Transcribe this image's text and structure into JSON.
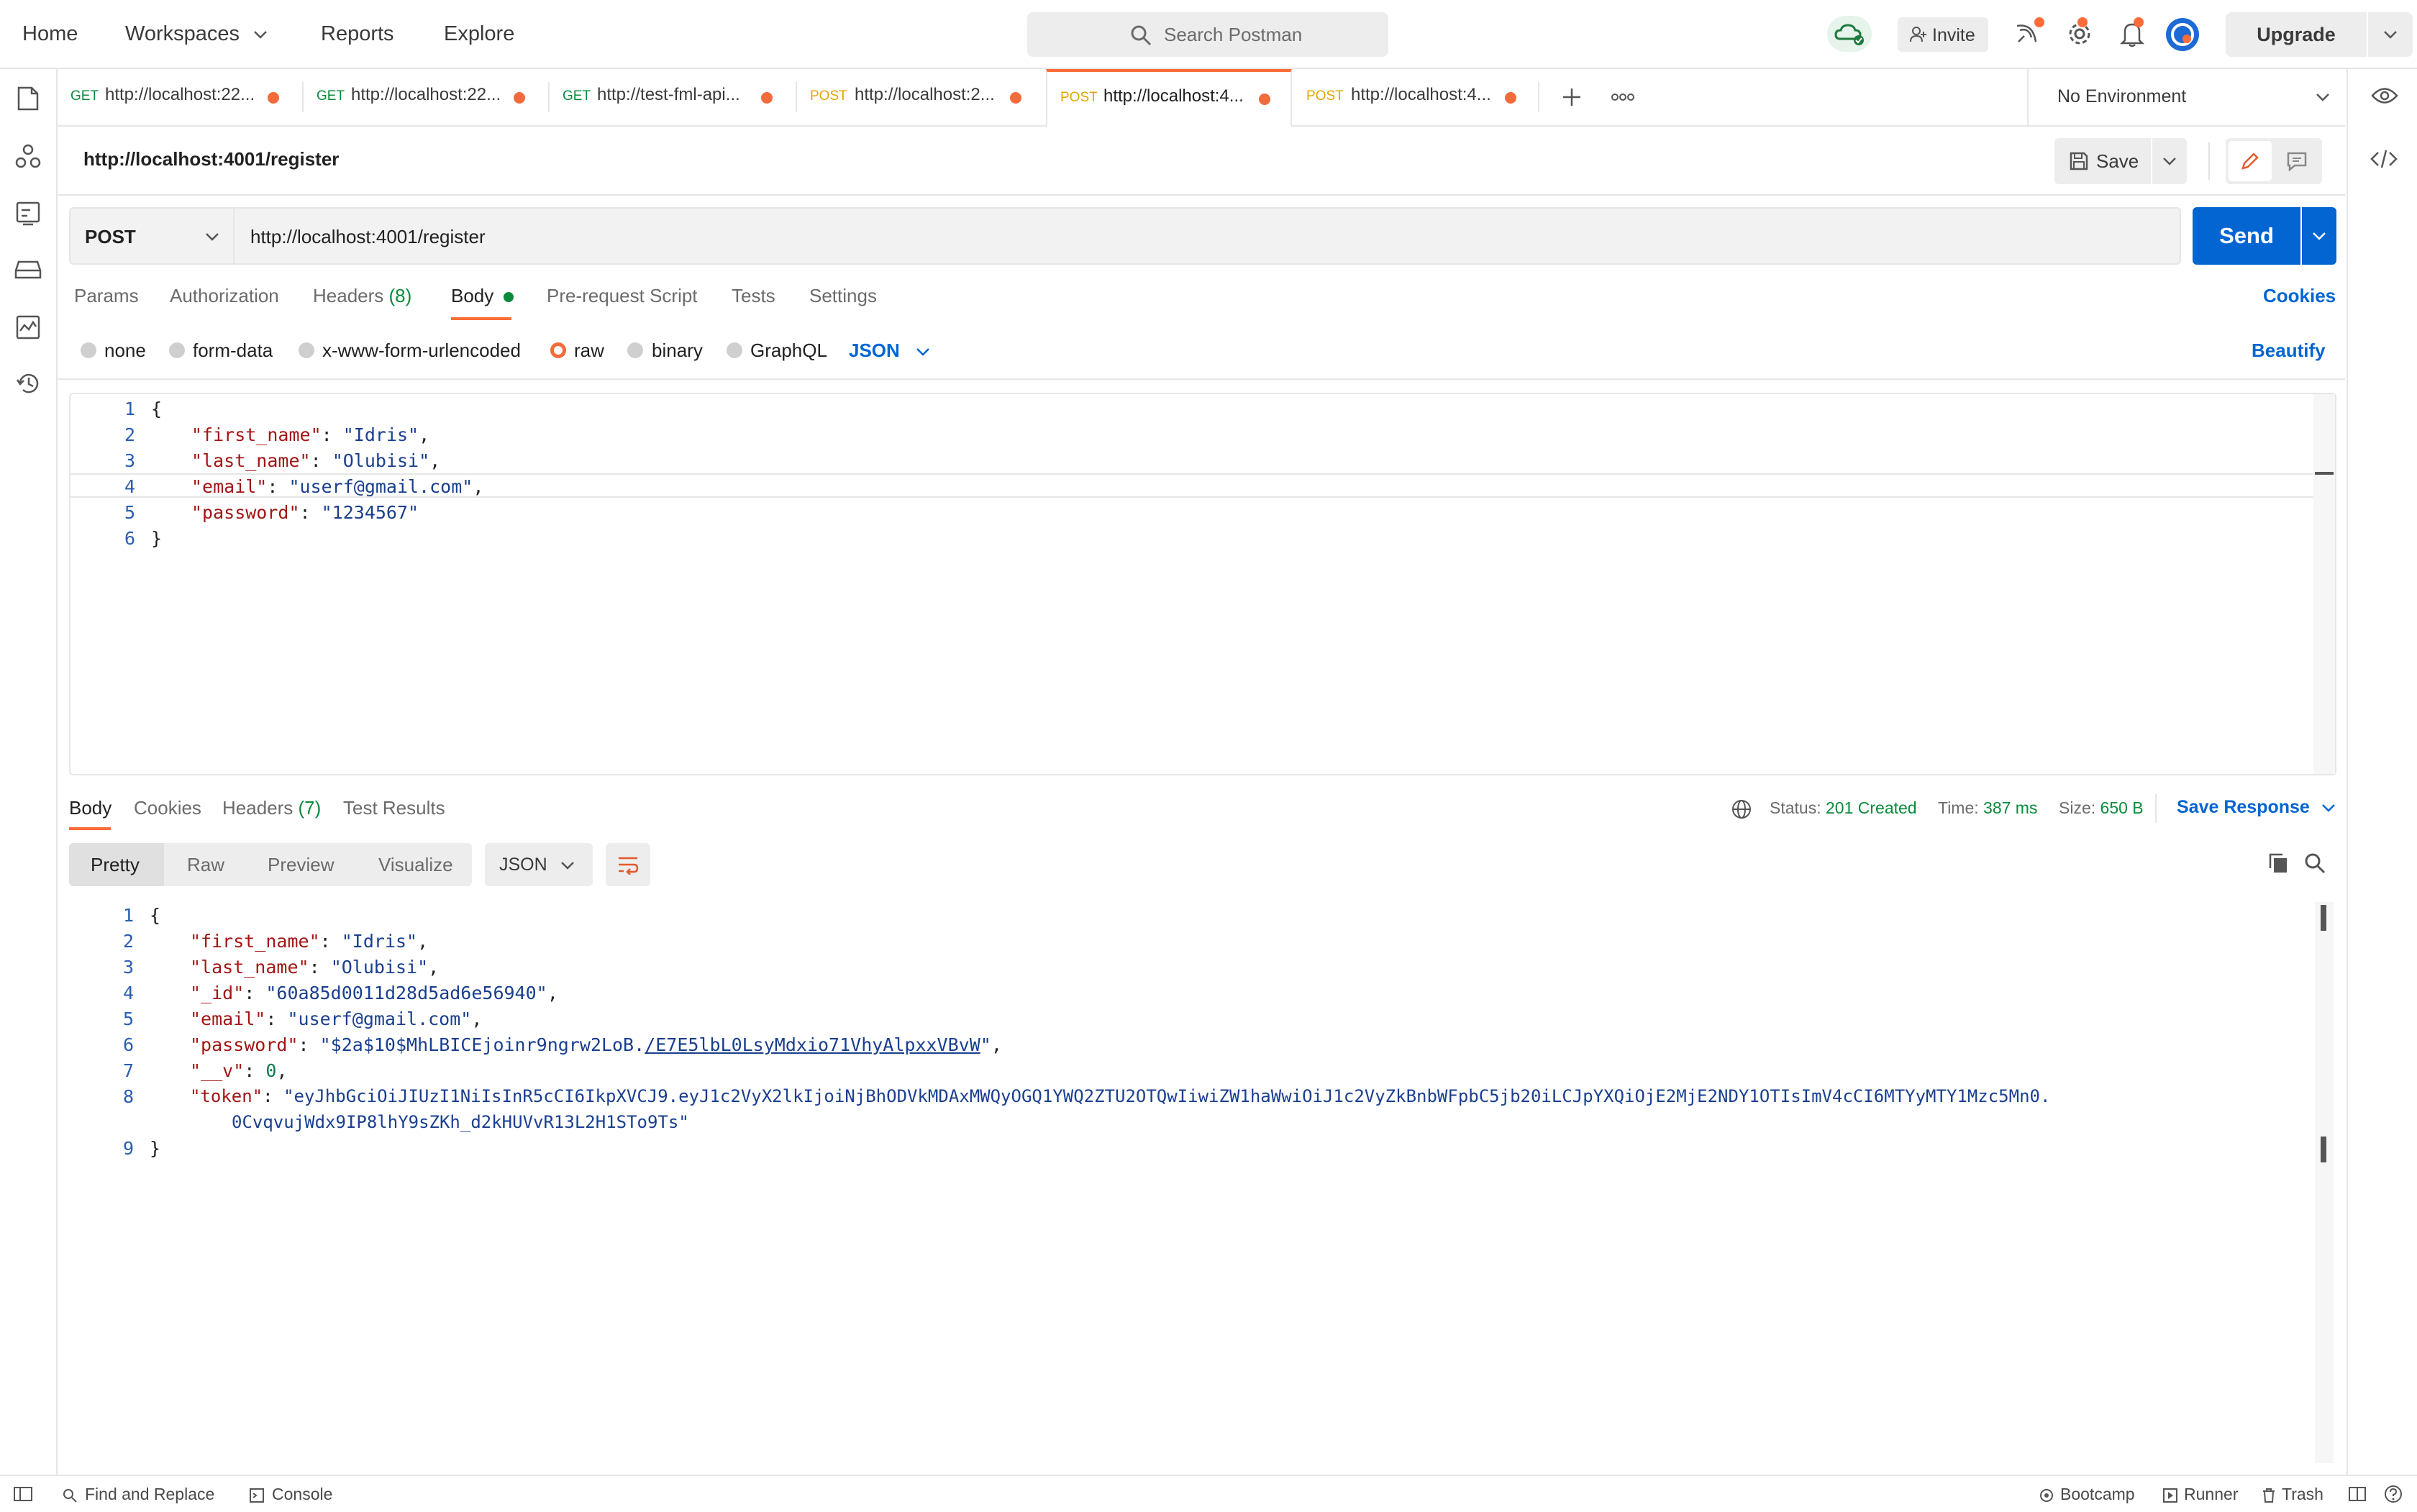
{
  "topbar": {
    "nav": [
      "Home",
      "Workspaces",
      "Reports",
      "Explore"
    ],
    "search_placeholder": "Search Postman",
    "invite_label": "Invite",
    "upgrade_label": "Upgrade"
  },
  "tabs": [
    {
      "method": "GET",
      "url": "http://localhost:22...",
      "method_color": "#0b8a3b"
    },
    {
      "method": "GET",
      "url": "http://localhost:22...",
      "method_color": "#0b8a3b"
    },
    {
      "method": "GET",
      "url": "http://test-fml-api...",
      "method_color": "#0b8a3b"
    },
    {
      "method": "POST",
      "url": "http://localhost:2...",
      "method_color": "#e2a500"
    },
    {
      "method": "POST",
      "url": "http://localhost:4...",
      "method_color": "#e2a500"
    },
    {
      "method": "POST",
      "url": "http://localhost:4...",
      "method_color": "#e2a500"
    }
  ],
  "environment": "No Environment",
  "request": {
    "title": "http://localhost:4001/register",
    "save_label": "Save",
    "method": "POST",
    "url": "http://localhost:4001/register",
    "send_label": "Send",
    "tabs": {
      "params": "Params",
      "authorization": "Authorization",
      "headers": "Headers",
      "headers_count": "(8)",
      "body": "Body",
      "prerequest": "Pre-request Script",
      "tests": "Tests",
      "settings": "Settings"
    },
    "cookies_link": "Cookies",
    "body_types": {
      "none": "none",
      "form_data": "form-data",
      "urlencoded": "x-www-form-urlencoded",
      "raw": "raw",
      "binary": "binary",
      "graphql": "GraphQL"
    },
    "language": "JSON",
    "beautify": "Beautify",
    "body_lines": {
      "l1": "{",
      "l2_key": "\"first_name\"",
      "l2_val": "\"Idris\"",
      "l3_key": "\"last_name\"",
      "l3_val": "\"Olubisi\"",
      "l4_key": "\"email\"",
      "l4_val": "\"userf@gmail.com\"",
      "l5_key": "\"password\"",
      "l5_val": "\"1234567\"",
      "l6": "}"
    }
  },
  "response": {
    "tabs": {
      "body": "Body",
      "cookies": "Cookies",
      "headers": "Headers",
      "headers_count": "(7)",
      "test_results": "Test Results"
    },
    "status_label": "Status:",
    "status_value": "201 Created",
    "time_label": "Time:",
    "time_value": "387 ms",
    "size_label": "Size:",
    "size_value": "650 B",
    "save_response": "Save Response",
    "formats": {
      "pretty": "Pretty",
      "raw": "Raw",
      "preview": "Preview",
      "visualize": "Visualize"
    },
    "language": "JSON",
    "body_lines": {
      "l1": "{",
      "l2_key": "\"first_name\"",
      "l2_val": "\"Idris\"",
      "l3_key": "\"last_name\"",
      "l3_val": "\"Olubisi\"",
      "l4_key": "\"_id\"",
      "l4_val": "\"60a85d0011d28d5ad6e56940\"",
      "l5_key": "\"email\"",
      "l5_val": "\"userf@gmail.com\"",
      "l6_key": "\"password\"",
      "l6_val_a": "\"$2a$10$MhLBICEjoinr9ngrw2LoB.",
      "l6_val_link": "/E7E5lbL0LsyMdxio71VhyAlpxxVBvW",
      "l6_val_b": "\"",
      "l7_key": "\"__v\"",
      "l7_val": "0",
      "l8_key": "\"token\"",
      "l8_val_a": "\"eyJhbGciOiJIUzI1NiIsInR5cCI6IkpXVCJ9.eyJ1c2VyX2lkIjoiNjBhODVkMDAxMWQyOGQ1YWQ2ZTU2OTQwIiwiZW1haWwiOiJ1c2VyZkBnbWFpbC5jb20iLCJpYXQiOjE2MjE2NDY1OTIsImV4cCI6MTYyMTY1Mzc5Mn0.",
      "l8_val_b": "0CvqvujWdx9IP8lhY9sZKh_d2kHUVvR13L2H1STo9Ts\"",
      "l9": "}"
    }
  },
  "statusbar": {
    "find_replace": "Find and Replace",
    "console": "Console",
    "bootcamp": "Bootcamp",
    "runner": "Runner",
    "trash": "Trash"
  }
}
